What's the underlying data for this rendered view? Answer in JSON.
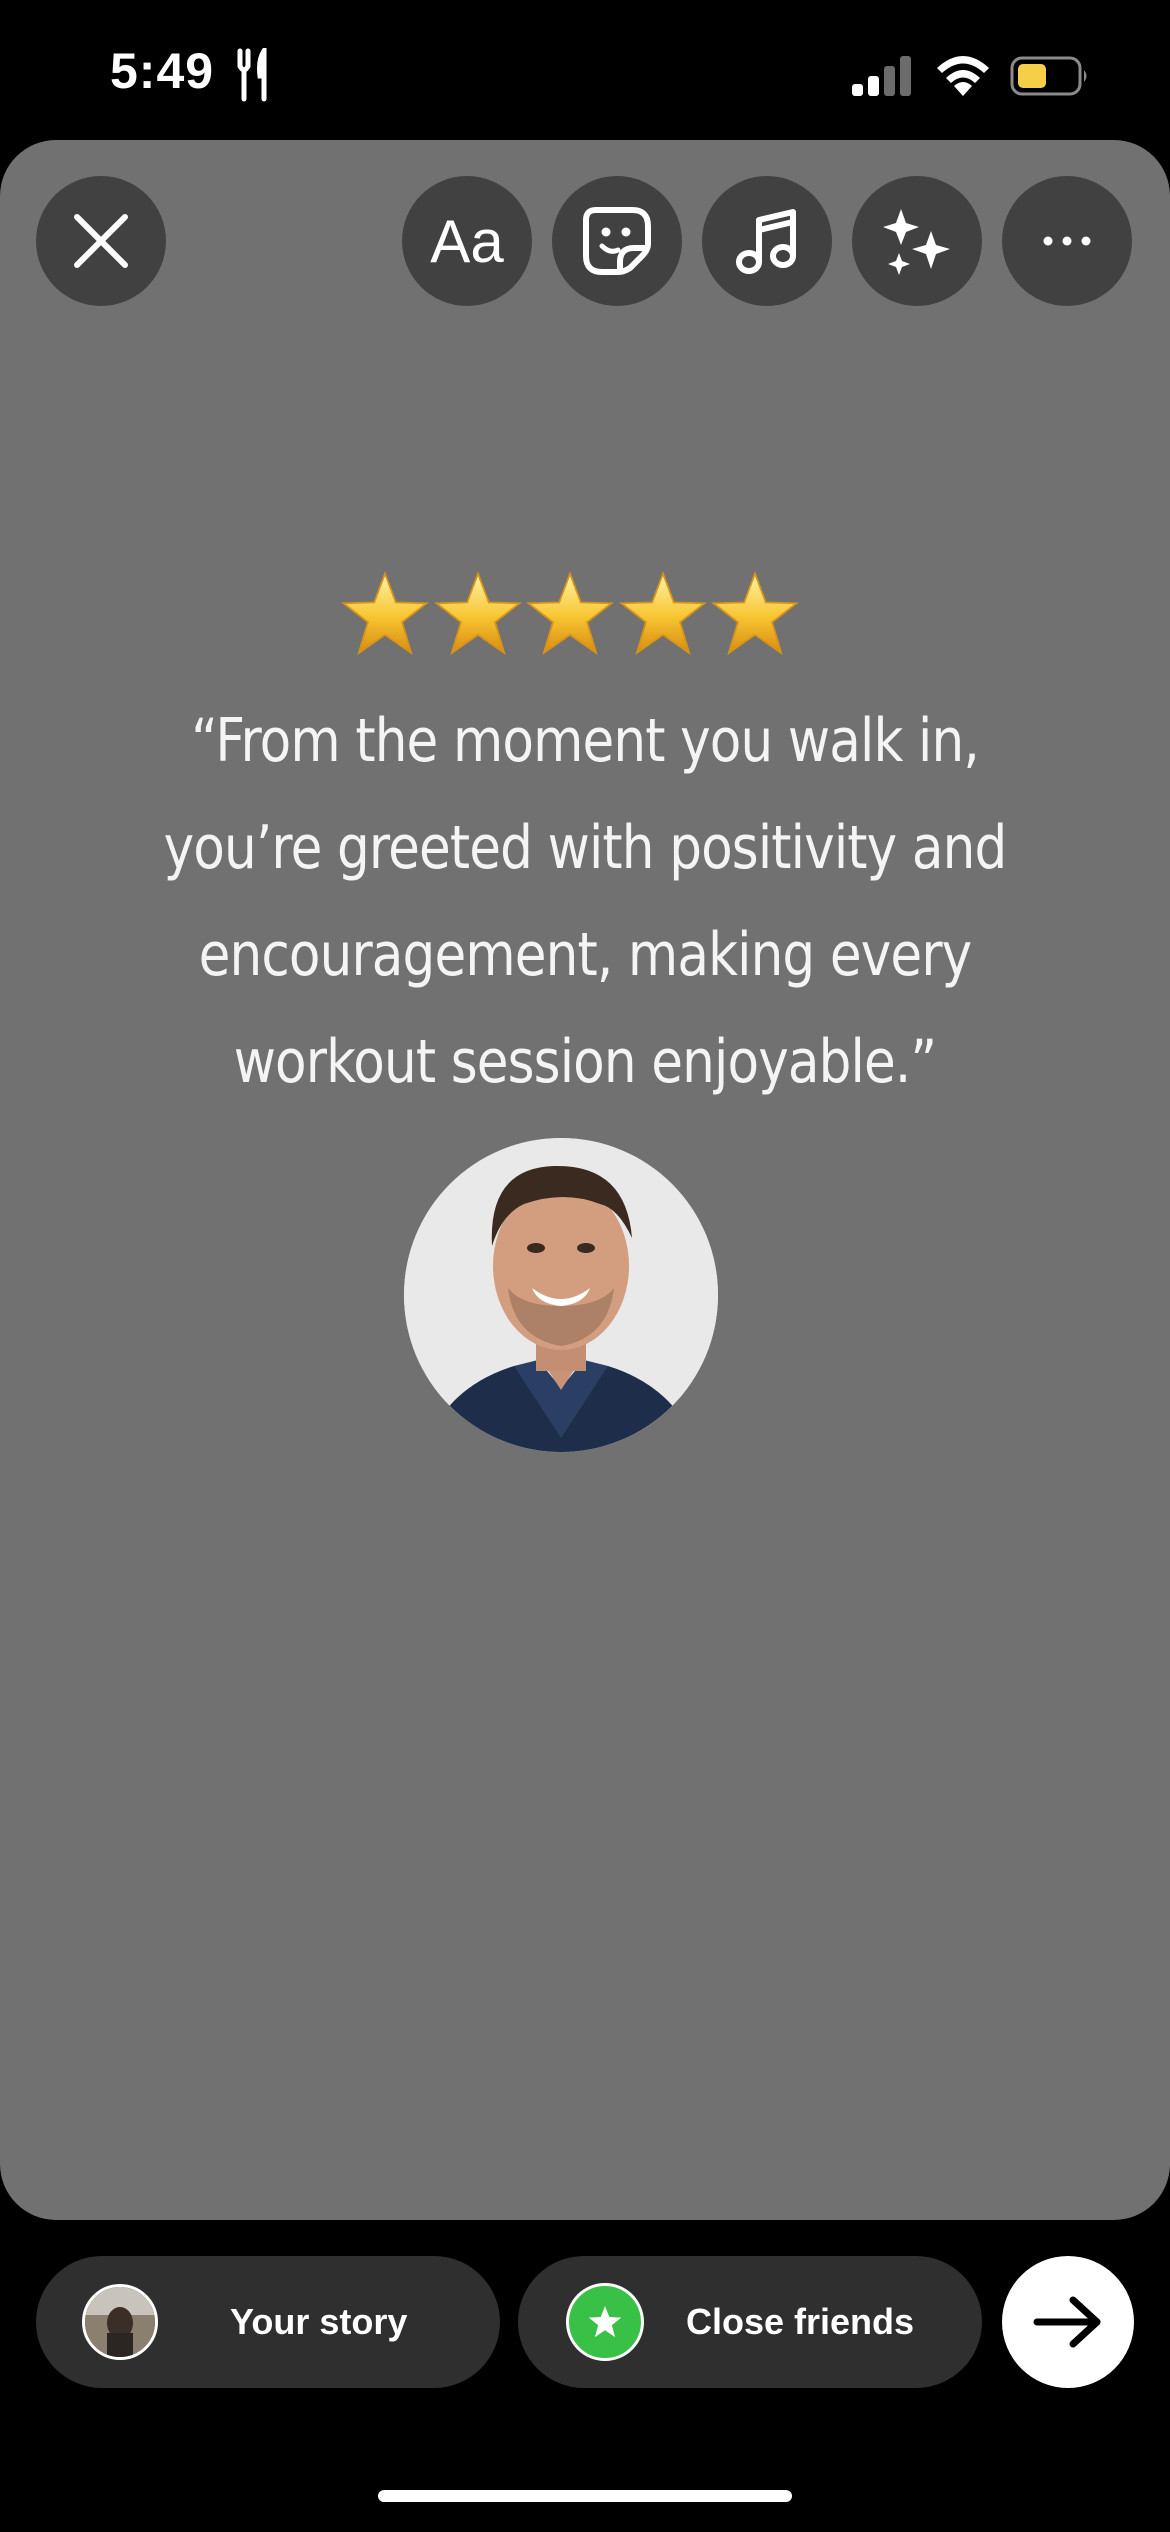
{
  "status_bar": {
    "time": "5:49",
    "battery_color": "#f5cf47"
  },
  "toolbar": {
    "text_label": "Aa",
    "icons": [
      "close-icon",
      "text-icon",
      "sticker-icon",
      "music-icon",
      "effects-icon",
      "more-icon"
    ]
  },
  "review": {
    "rating": 5,
    "rating_max": 5,
    "quote_lines": [
      "“From the moment you walk in,",
      "you’re greeted with positivity and",
      "encouragement, making every",
      "workout session enjoyable.”"
    ]
  },
  "share": {
    "your_story_label": "Your story",
    "close_friends_label": "Close friends",
    "accent_color": "#39c046"
  }
}
